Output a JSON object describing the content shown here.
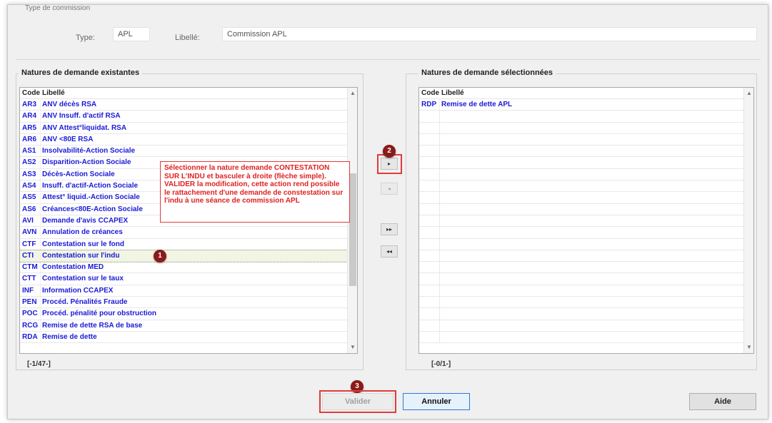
{
  "header": {
    "type_label": "Type:",
    "type_value": "APL",
    "libelle_label": "Libellé:",
    "libelle_value": "Commission APL"
  },
  "left_list": {
    "title": "Natures de demande existantes",
    "col_code": "Code",
    "col_libelle": "Libellé",
    "rows": [
      {
        "code": "AR3",
        "libelle": "ANV décès RSA"
      },
      {
        "code": "AR4",
        "libelle": "ANV Insuff. d'actif RSA"
      },
      {
        "code": "AR5",
        "libelle": "ANV Attest°liquidat. RSA"
      },
      {
        "code": "AR6",
        "libelle": "ANV <80E RSA"
      },
      {
        "code": "AS1",
        "libelle": "Insolvabilité-Action Sociale"
      },
      {
        "code": "AS2",
        "libelle": "Disparition-Action Sociale"
      },
      {
        "code": "AS3",
        "libelle": "Décès-Action Sociale"
      },
      {
        "code": "AS4",
        "libelle": "Insuff. d'actif-Action Sociale"
      },
      {
        "code": "AS5",
        "libelle": "Attest° liquid.-Action Sociale"
      },
      {
        "code": "AS6",
        "libelle": "Créances<80E-Action Sociale"
      },
      {
        "code": "AVI",
        "libelle": "Demande d'avis CCAPEX"
      },
      {
        "code": "AVN",
        "libelle": "Annulation de créances"
      },
      {
        "code": "CTF",
        "libelle": "Contestation sur le fond"
      },
      {
        "code": "CTI",
        "libelle": "Contestation sur l'indu"
      },
      {
        "code": "CTM",
        "libelle": "Contestation MED"
      },
      {
        "code": "CTT",
        "libelle": "Contestation sur le taux"
      },
      {
        "code": "INF",
        "libelle": "Information CCAPEX"
      },
      {
        "code": "PEN",
        "libelle": "Procéd. Pénalités Fraude"
      },
      {
        "code": "POC",
        "libelle": "Procéd. pénalité pour obstruction"
      },
      {
        "code": "RCG",
        "libelle": "Remise de dette RSA de base"
      },
      {
        "code": "RDA",
        "libelle": "Remise de dette"
      }
    ],
    "selected_code": "CTI",
    "counter": "[-1/47-]"
  },
  "right_list": {
    "title": "Natures de demande sélectionnées",
    "col_code": "Code",
    "col_libelle": "Libellé",
    "rows": [
      {
        "code": "RDP",
        "libelle": "Remise de dette APL"
      }
    ],
    "counter": "[-0/1-]"
  },
  "transfer": {
    "move_right": "▸",
    "move_left": "◂",
    "move_all_right": "▸▸",
    "move_all_left": "◂◂"
  },
  "annotation": {
    "text": "Sélectionner la nature demande CONTESTATION SUR L'INDU et basculer à droite (flèche simple). VALIDER la modification, cette action rend possible le rattachement d'une demande de constestation sur l'indu à une séance de commission APL",
    "badge1": "1",
    "badge2": "2",
    "badge3": "3"
  },
  "buttons": {
    "valider": "Valider",
    "annuler": "Annuler",
    "aide": "Aide"
  },
  "colors": {
    "code_text": "#1a1ad6",
    "highlight_red": "#e03b3b",
    "badge": "#8b1a1a"
  }
}
